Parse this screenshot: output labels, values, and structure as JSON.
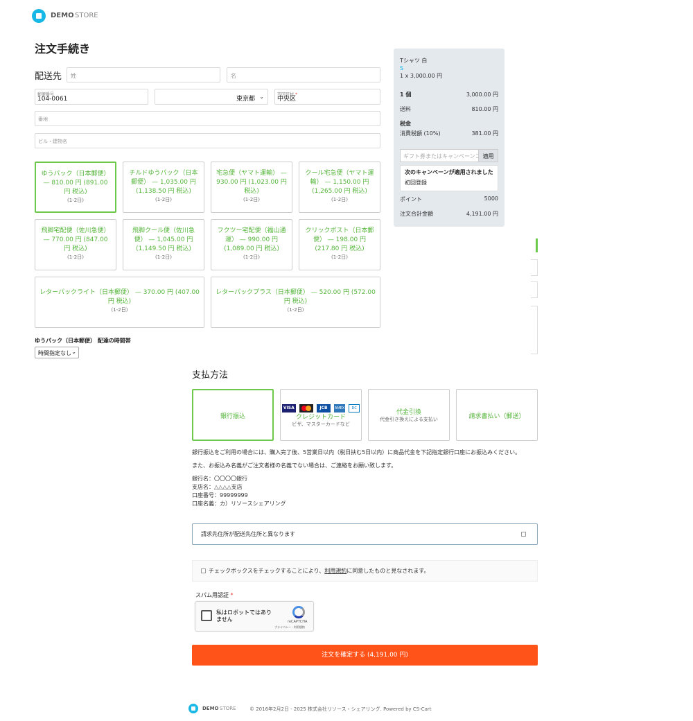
{
  "header": {
    "logo_bold": "DEMO",
    "logo_thin": "STORE"
  },
  "page_title": "注文手続き",
  "shipping_address": {
    "heading": "配送先",
    "last_name_placeholder": "姓",
    "first_name_placeholder": "名",
    "postal_label": "郵便番号",
    "postal_value": "104-0061",
    "prefecture": "東京都",
    "city_label": "市区町村",
    "city_required": "*",
    "city_value": "中央区",
    "address_placeholder": "番地",
    "building_placeholder": "ビル・建物名"
  },
  "shipping_methods": [
    {
      "label": "ゆうパック（日本郵便） — 810.00 円 (891.00 円 税込)",
      "time": "(1-2日)",
      "selected": true
    },
    {
      "label": "チルドゆうパック（日本郵便） — 1,035.00 円 (1,138.50 円 税込)",
      "time": "(1-2日)",
      "selected": false
    },
    {
      "label": "宅急便（ヤマト運輸） — 930.00 円 (1,023.00 円 税込)",
      "time": "(1-2日)",
      "selected": false
    },
    {
      "label": "クール宅急便（ヤマト運輸） — 1,150.00 円 (1,265.00 円 税込)",
      "time": "(1-2日)",
      "selected": false
    },
    {
      "label": "飛脚宅配便（佐川急便） — 770.00 円 (847.00 円 税込)",
      "time": "(1-2日)",
      "selected": false
    },
    {
      "label": "飛脚クール便（佐川急便） — 1,045.00 円 (1,149.50 円 税込)",
      "time": "(1-2日)",
      "selected": false
    },
    {
      "label": "フクツー宅配便（福山通運） — 990.00 円 (1,089.00 円 税込)",
      "time": "(1-2日)",
      "selected": false
    },
    {
      "label": "クリックポスト（日本郵便） — 198.00 円 (217.80 円 税込)",
      "time": "(1-2日)",
      "selected": false
    },
    {
      "label": "レターパックライト（日本郵便） — 370.00 円 (407.00 円 税込)",
      "time": "(1-2日)",
      "selected": false
    },
    {
      "label": "レターパックプラス（日本郵便） — 520.00 円 (572.00 円 税込)",
      "time": "(1-2日)",
      "selected": false
    }
  ],
  "delivery_time": {
    "label": "ゆうパック（日本郵便） 配達の時間帯",
    "selected": "時間指定なし"
  },
  "summary": {
    "product_name": "Tシャツ 白",
    "product_variant": "S",
    "product_qty_price": "1 x 3,000.00 円",
    "items_label": "1 個",
    "items_value": "3,000.00 円",
    "shipping_label": "送料",
    "shipping_value": "810.00 円",
    "tax_heading": "税金",
    "tax_label": "消費税額 (10%)",
    "tax_value": "381.00 円",
    "coupon_placeholder": "ギフト券またはキャンペーンコード",
    "coupon_button": "適用",
    "campaign_heading": "次のキャンペーンが適用されました",
    "campaign_name": "初回登録",
    "points_label": "ポイント",
    "points_value": "5000",
    "total_label": "注文合計金額",
    "total_value": "4,191.00 円"
  },
  "payment": {
    "heading": "支払方法",
    "methods": [
      {
        "title": "銀行振込",
        "desc": "",
        "selected": true
      },
      {
        "title": "クレジットカード",
        "desc": "ビザ、マスターカードなど",
        "selected": false
      },
      {
        "title": "代金引換",
        "desc": "代金引き換えによる支払い",
        "selected": false
      },
      {
        "title": "請求書払い（郵送）",
        "desc": "",
        "selected": false
      }
    ],
    "card_logos": [
      "VISA",
      "MC",
      "JCB",
      "AMEX",
      "DC"
    ],
    "instruction_1": "銀行振込をご利用の場合には、購入完了後、5営業日以内（税日扶む5日以内）に商品代金を下記指定銀行口座にお振込みください。",
    "instruction_2": "また、お振込み名義がご注文者様の名義でない場合は、ご連絡をお願い致します。",
    "bank_name": "銀行名：〇〇〇〇銀行",
    "branch": "支店名：△△△△支店",
    "account_no": "口座番号：99999999",
    "account_name": "口座名義：カ）リソースシェアリング"
  },
  "billing_toggle": "請求先住所が配送先住所と異なります",
  "terms": {
    "prefix": "チェックボックスをチェックすることにより、",
    "link": "利用規約",
    "suffix": "に同意したものと見なされます。"
  },
  "captcha": {
    "label": "スパム用認証",
    "required": "*",
    "checkbox_text": "私はロボットではありません",
    "brand": "reCAPTCHA",
    "links": "プライバシー・利用規約"
  },
  "submit_button": "注文を確定する (4,191.00 円)",
  "footer": {
    "logo_bold": "DEMO",
    "logo_thin": "STORE",
    "copyright": "© 2016年2月2日 - 2025 株式会社リソース・シェアリング.",
    "powered": "Powered by CS-Cart"
  },
  "colors": {
    "accent_green": "#55b53b",
    "submit_orange": "#ff5319",
    "logo_blue": "#17b8e6",
    "summary_bg": "#e4e9ee"
  }
}
